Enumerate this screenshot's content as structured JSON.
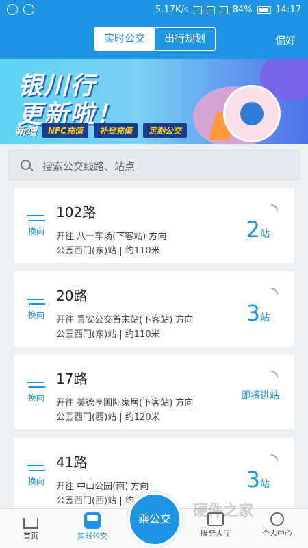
{
  "status_bar": {
    "speed": "5.17K/s",
    "battery": "84%",
    "time": "14:17"
  },
  "header": {
    "tabs": [
      {
        "label": "实时公交",
        "active": true
      },
      {
        "label": "出行规划",
        "active": false
      }
    ],
    "preference_label": "偏好"
  },
  "banner": {
    "line1": "银川行",
    "line2": "更新啦！",
    "new_label": "新增",
    "tags": [
      "NFC充值",
      "补登充值",
      "定制公交"
    ]
  },
  "search": {
    "placeholder": "搜索公交线路、站点"
  },
  "routes": [
    {
      "name": "102路",
      "swap_label": "换向",
      "direction": "开往 八一车场(下客站) 方向",
      "stop": "公园西门(东)站 | 约110米",
      "eta_num": "2",
      "eta_unit": "站",
      "eta_text": ""
    },
    {
      "name": "20路",
      "swap_label": "换向",
      "direction": "开往 景安公交首末站(下客站) 方向",
      "stop": "公园西门(东)站 | 约110米",
      "eta_num": "3",
      "eta_unit": "站",
      "eta_text": ""
    },
    {
      "name": "17路",
      "swap_label": "换向",
      "direction": "开往 美德亨国际家居(下客站) 方向",
      "stop": "公园西门(西)站 | 约120米",
      "eta_num": "",
      "eta_unit": "",
      "eta_text": "即将进站"
    },
    {
      "name": "41路",
      "swap_label": "换向",
      "direction": "开往 中山公园(南) 方向",
      "stop": "公园西门(西)站 | 约",
      "eta_num": "3",
      "eta_unit": "站",
      "eta_text": ""
    }
  ],
  "bottom_nav": {
    "items": [
      {
        "label": "首页",
        "icon": "home-icon"
      },
      {
        "label": "实时公交",
        "icon": "bus-icon"
      },
      {
        "label": "服务大厅",
        "icon": "service-hall-icon"
      },
      {
        "label": "个人中心",
        "icon": "user-icon"
      }
    ],
    "ride_button": "乘公交"
  },
  "watermark": "硬件之家",
  "colors": {
    "primary": "#1d95e3"
  }
}
